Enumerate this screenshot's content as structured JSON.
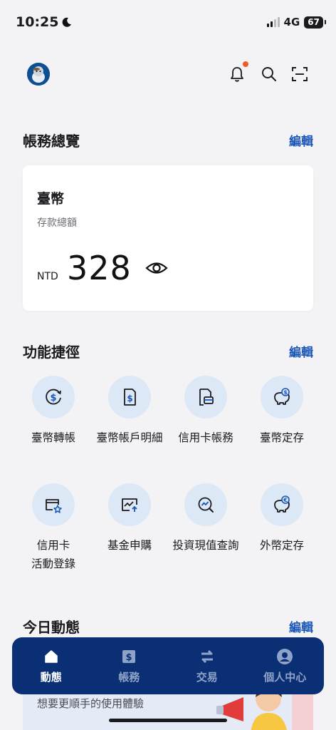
{
  "status": {
    "time": "10:25",
    "network": "4G",
    "battery": "67"
  },
  "colors": {
    "accent": "#1a56b8",
    "nav_bg": "#0b2f74",
    "notif_dot": "#f05a28",
    "circle_bg": "#dde8f6"
  },
  "overview": {
    "title": "帳務總覽",
    "edit": "編輯"
  },
  "balance": {
    "title": "臺幣",
    "subtitle": "存款總額",
    "currency": "NTD",
    "amount": "328"
  },
  "shortcuts": {
    "title": "功能捷徑",
    "edit": "編輯",
    "items": [
      {
        "label": "臺幣轉帳",
        "icon": "dollar-refresh-icon"
      },
      {
        "label": "臺幣帳戶明細",
        "icon": "dollar-document-icon"
      },
      {
        "label": "信用卡帳務",
        "icon": "card-document-icon"
      },
      {
        "label": "臺幣定存",
        "icon": "piggy-bank-icon"
      },
      {
        "label": "信用卡",
        "label2": "活動登錄",
        "icon": "card-star-icon"
      },
      {
        "label": "基金申購",
        "icon": "chart-up-icon"
      },
      {
        "label": "投資現值查詢",
        "icon": "search-chart-icon"
      },
      {
        "label": "外幣定存",
        "icon": "piggy-euro-icon"
      }
    ]
  },
  "today": {
    "title": "今日動態",
    "edit": "編輯"
  },
  "promo": {
    "text": "想要更順手的使用體驗"
  },
  "nav": {
    "items": [
      {
        "label": "動態",
        "icon": "home-icon",
        "active": true
      },
      {
        "label": "帳務",
        "icon": "dollar-square-icon",
        "active": false
      },
      {
        "label": "交易",
        "icon": "transfer-arrows-icon",
        "active": false
      },
      {
        "label": "個人中心",
        "icon": "person-icon",
        "active": false
      }
    ]
  }
}
